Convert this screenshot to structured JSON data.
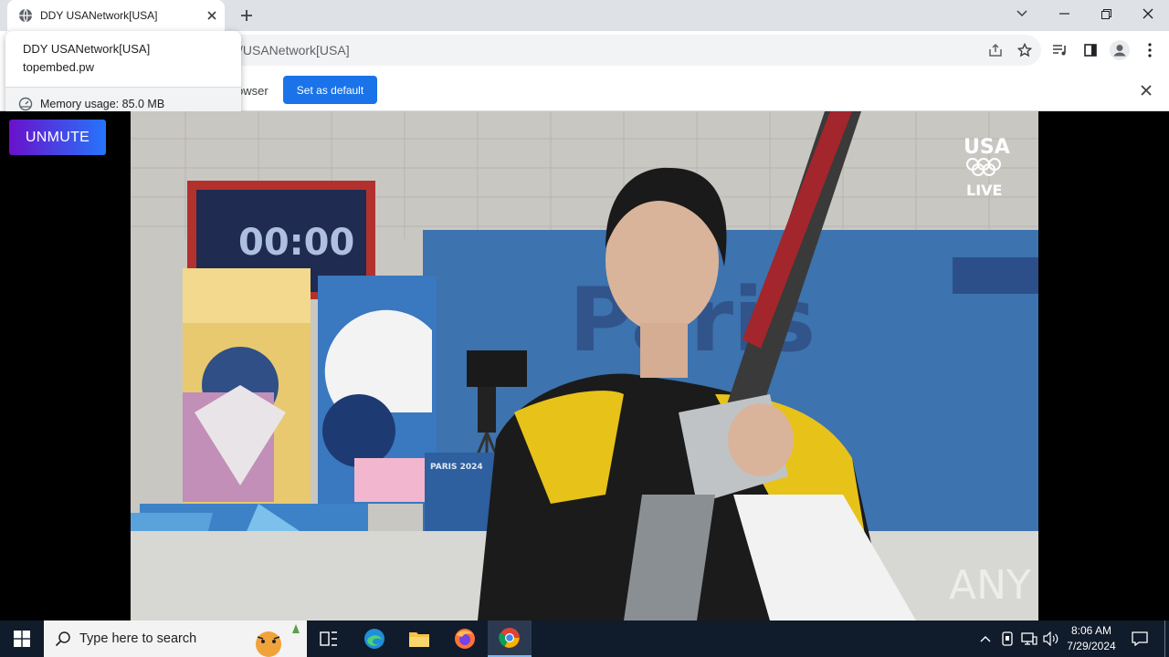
{
  "browser": {
    "tab_title": "DDY USANetwork[USA]",
    "url_visible": "/USANetwork[USA]",
    "infobar_text": "owser",
    "set_default_label": "Set as default"
  },
  "hovercard": {
    "title": "DDY USANetwork[USA]",
    "domain": "topembed.pw",
    "memory": "Memory usage: 85.0 MB"
  },
  "page": {
    "unmute_label": "UNMUTE"
  },
  "video": {
    "scoreboard_time": "00:00",
    "network_logo": "USA",
    "live_label": "LIVE",
    "background_text": "Paris",
    "sign_text": "PARIS 2024",
    "watermark": "ANY RUN"
  },
  "taskbar": {
    "search_placeholder": "Type here to search",
    "time": "8:06 AM",
    "date": "7/29/2024"
  },
  "colors": {
    "accent_blue": "#1a73e8",
    "unmute_start": "#6a11cb",
    "unmute_end": "#2575fc",
    "taskbar": "#101b2b"
  }
}
